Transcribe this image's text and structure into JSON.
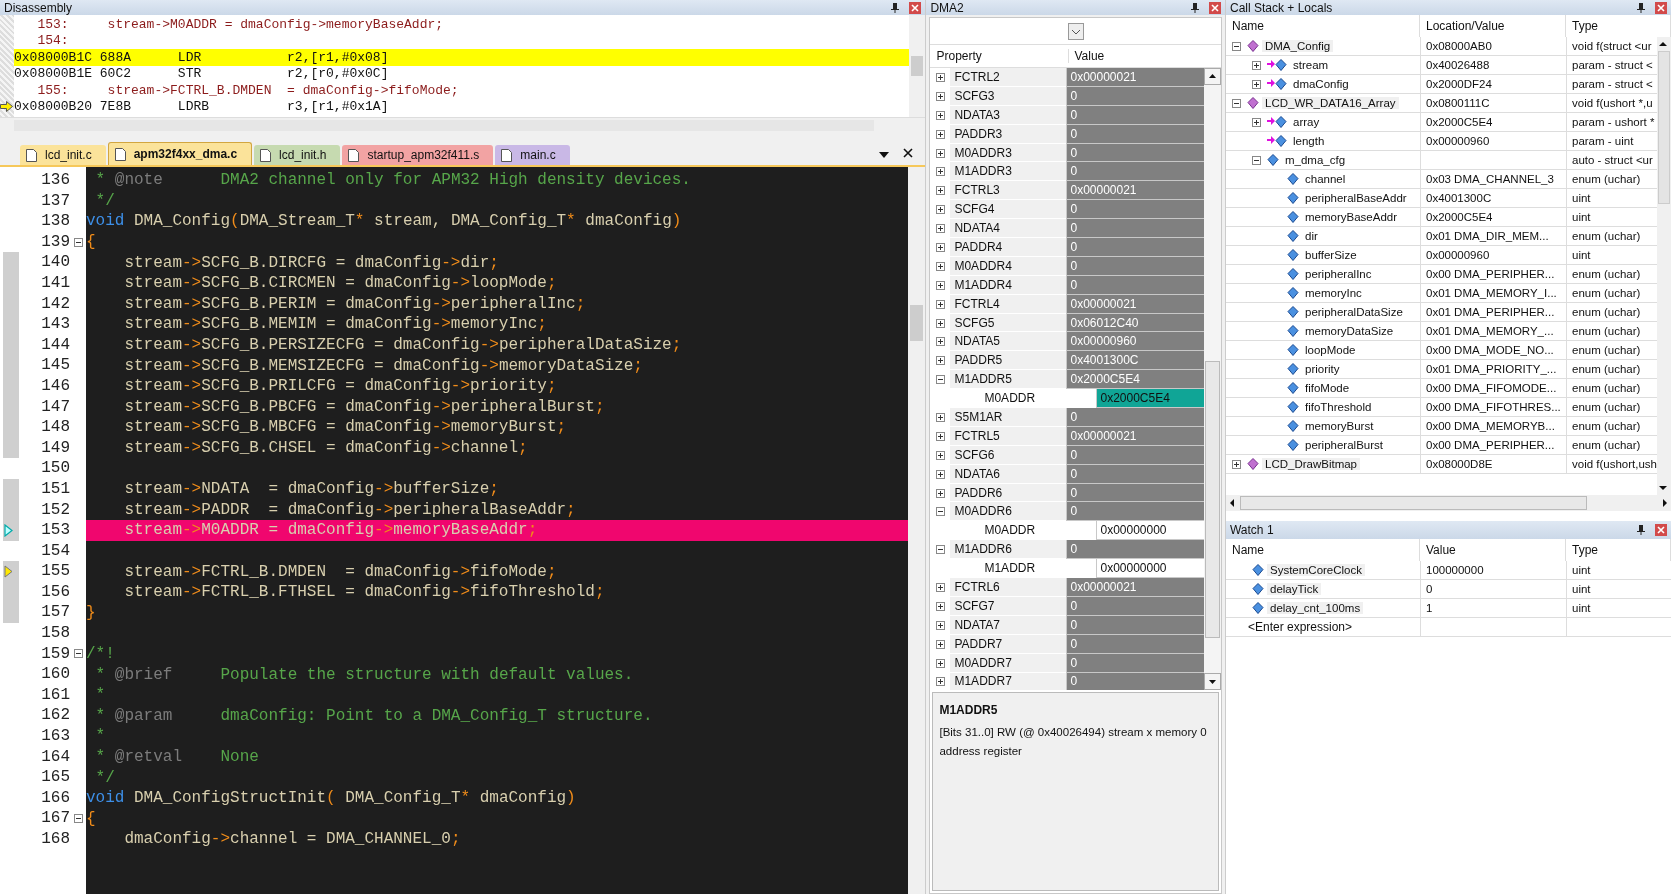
{
  "disassembly": {
    "title": "Disassembly",
    "lines": [
      {
        "kind": "source",
        "text": "   153:     stream->M0ADDR = dmaConfig->memoryBaseAddr;",
        "highlight": false,
        "current": false
      },
      {
        "kind": "source",
        "text": "   154:",
        "highlight": false,
        "current": false
      },
      {
        "kind": "asm",
        "text": "0x08000B1C 688A      LDR           r2,[r1,#0x08]",
        "highlight": true,
        "current": false
      },
      {
        "kind": "asm",
        "text": "0x08000B1E 60C2      STR           r2,[r0,#0x0C]",
        "highlight": false,
        "current": false
      },
      {
        "kind": "source",
        "text": "   155:     stream->FCTRL_B.DMDEN  = dmaConfig->fifoMode;",
        "highlight": false,
        "current": false
      },
      {
        "kind": "asm",
        "text": "0x08000B20 7E8B      LDRB          r3,[r1,#0x1A]",
        "highlight": false,
        "current": true
      }
    ]
  },
  "tabs": [
    {
      "label": "lcd_init.c",
      "selected": false,
      "color": "#fbe39a"
    },
    {
      "label": "apm32f4xx_dma.c",
      "selected": true,
      "color": "#fbe39a"
    },
    {
      "label": "lcd_init.h",
      "selected": false,
      "color": "#c6dab0"
    },
    {
      "label": "startup_apm32f411.s",
      "selected": false,
      "color": "#f2a3a3"
    },
    {
      "label": "main.c",
      "selected": false,
      "color": "#c9b8e6"
    }
  ],
  "editor": {
    "lines": [
      {
        "number": "136",
        "fold": false,
        "executed": false,
        "highlight": false,
        "parts": [
          {
            "kind": "comment",
            "text": " * "
          },
          {
            "kind": "tag",
            "text": "@note"
          },
          {
            "kind": "comment",
            "text": "      DMA2 channel only for APM32 High density devices."
          }
        ]
      },
      {
        "number": "137",
        "fold": false,
        "executed": false,
        "highlight": false,
        "parts": [
          {
            "kind": "comment",
            "text": " */"
          }
        ]
      },
      {
        "number": "138",
        "fold": false,
        "executed": false,
        "highlight": false,
        "parts": [
          {
            "kind": "keyword",
            "text": "void"
          },
          {
            "kind": "text",
            "text": " DMA_Config"
          },
          {
            "kind": "op",
            "text": "("
          },
          {
            "kind": "text",
            "text": "DMA_Stream_T"
          },
          {
            "kind": "op",
            "text": "*"
          },
          {
            "kind": "text",
            "text": " stream, DMA_Config_T"
          },
          {
            "kind": "op",
            "text": "*"
          },
          {
            "kind": "text",
            "text": " dmaConfig"
          },
          {
            "kind": "op",
            "text": ")"
          }
        ]
      },
      {
        "number": "139",
        "fold": true,
        "executed": false,
        "highlight": false,
        "parts": [
          {
            "kind": "op",
            "text": "{"
          }
        ]
      },
      {
        "number": "140",
        "fold": false,
        "executed": true,
        "highlight": false,
        "parts": [
          {
            "kind": "text",
            "text": "    stream"
          },
          {
            "kind": "op",
            "text": "->"
          },
          {
            "kind": "text",
            "text": "SCFG_B.DIRCFG = dmaConfig"
          },
          {
            "kind": "op",
            "text": "->"
          },
          {
            "kind": "text",
            "text": "dir"
          },
          {
            "kind": "op",
            "text": ";"
          }
        ]
      },
      {
        "number": "141",
        "fold": false,
        "executed": true,
        "highlight": false,
        "parts": [
          {
            "kind": "text",
            "text": "    stream"
          },
          {
            "kind": "op",
            "text": "->"
          },
          {
            "kind": "text",
            "text": "SCFG_B.CIRCMEN = dmaConfig"
          },
          {
            "kind": "op",
            "text": "->"
          },
          {
            "kind": "text",
            "text": "loopMode"
          },
          {
            "kind": "op",
            "text": ";"
          }
        ]
      },
      {
        "number": "142",
        "fold": false,
        "executed": true,
        "highlight": false,
        "parts": [
          {
            "kind": "text",
            "text": "    stream"
          },
          {
            "kind": "op",
            "text": "->"
          },
          {
            "kind": "text",
            "text": "SCFG_B.PERIM = dmaConfig"
          },
          {
            "kind": "op",
            "text": "->"
          },
          {
            "kind": "text",
            "text": "peripheralInc"
          },
          {
            "kind": "op",
            "text": ";"
          }
        ]
      },
      {
        "number": "143",
        "fold": false,
        "executed": true,
        "highlight": false,
        "parts": [
          {
            "kind": "text",
            "text": "    stream"
          },
          {
            "kind": "op",
            "text": "->"
          },
          {
            "kind": "text",
            "text": "SCFG_B.MEMIM = dmaConfig"
          },
          {
            "kind": "op",
            "text": "->"
          },
          {
            "kind": "text",
            "text": "memoryInc"
          },
          {
            "kind": "op",
            "text": ";"
          }
        ]
      },
      {
        "number": "144",
        "fold": false,
        "executed": true,
        "highlight": false,
        "parts": [
          {
            "kind": "text",
            "text": "    stream"
          },
          {
            "kind": "op",
            "text": "->"
          },
          {
            "kind": "text",
            "text": "SCFG_B.PERSIZECFG = dmaConfig"
          },
          {
            "kind": "op",
            "text": "->"
          },
          {
            "kind": "text",
            "text": "peripheralDataSize"
          },
          {
            "kind": "op",
            "text": ";"
          }
        ]
      },
      {
        "number": "145",
        "fold": false,
        "executed": true,
        "highlight": false,
        "parts": [
          {
            "kind": "text",
            "text": "    stream"
          },
          {
            "kind": "op",
            "text": "->"
          },
          {
            "kind": "text",
            "text": "SCFG_B.MEMSIZECFG = dmaConfig"
          },
          {
            "kind": "op",
            "text": "->"
          },
          {
            "kind": "text",
            "text": "memoryDataSize"
          },
          {
            "kind": "op",
            "text": ";"
          }
        ]
      },
      {
        "number": "146",
        "fold": false,
        "executed": true,
        "highlight": false,
        "parts": [
          {
            "kind": "text",
            "text": "    stream"
          },
          {
            "kind": "op",
            "text": "->"
          },
          {
            "kind": "text",
            "text": "SCFG_B.PRILCFG = dmaConfig"
          },
          {
            "kind": "op",
            "text": "->"
          },
          {
            "kind": "text",
            "text": "priority"
          },
          {
            "kind": "op",
            "text": ";"
          }
        ]
      },
      {
        "number": "147",
        "fold": false,
        "executed": true,
        "highlight": false,
        "parts": [
          {
            "kind": "text",
            "text": "    stream"
          },
          {
            "kind": "op",
            "text": "->"
          },
          {
            "kind": "text",
            "text": "SCFG_B.PBCFG = dmaConfig"
          },
          {
            "kind": "op",
            "text": "->"
          },
          {
            "kind": "text",
            "text": "peripheralBurst"
          },
          {
            "kind": "op",
            "text": ";"
          }
        ]
      },
      {
        "number": "148",
        "fold": false,
        "executed": true,
        "highlight": false,
        "parts": [
          {
            "kind": "text",
            "text": "    stream"
          },
          {
            "kind": "op",
            "text": "->"
          },
          {
            "kind": "text",
            "text": "SCFG_B.MBCFG = dmaConfig"
          },
          {
            "kind": "op",
            "text": "->"
          },
          {
            "kind": "text",
            "text": "memoryBurst"
          },
          {
            "kind": "op",
            "text": ";"
          }
        ]
      },
      {
        "number": "149",
        "fold": false,
        "executed": true,
        "highlight": false,
        "parts": [
          {
            "kind": "text",
            "text": "    stream"
          },
          {
            "kind": "op",
            "text": "->"
          },
          {
            "kind": "text",
            "text": "SCFG_B.CHSEL = dmaConfig"
          },
          {
            "kind": "op",
            "text": "->"
          },
          {
            "kind": "text",
            "text": "channel"
          },
          {
            "kind": "op",
            "text": ";"
          }
        ]
      },
      {
        "number": "150",
        "fold": false,
        "executed": false,
        "highlight": false
      },
      {
        "number": "151",
        "fold": false,
        "executed": true,
        "highlight": false,
        "parts": [
          {
            "kind": "text",
            "text": "    stream"
          },
          {
            "kind": "op",
            "text": "->"
          },
          {
            "kind": "text",
            "text": "NDATA  = dmaConfig"
          },
          {
            "kind": "op",
            "text": "->"
          },
          {
            "kind": "text",
            "text": "bufferSize"
          },
          {
            "kind": "op",
            "text": ";"
          }
        ]
      },
      {
        "number": "152",
        "fold": false,
        "executed": true,
        "highlight": false,
        "parts": [
          {
            "kind": "text",
            "text": "    stream"
          },
          {
            "kind": "op",
            "text": "->"
          },
          {
            "kind": "text",
            "text": "PADDR  = dmaConfig"
          },
          {
            "kind": "op",
            "text": "->"
          },
          {
            "kind": "text",
            "text": "peripheralBaseAddr"
          },
          {
            "kind": "op",
            "text": ";"
          }
        ]
      },
      {
        "number": "153",
        "fold": false,
        "executed": true,
        "highlight": true,
        "current": true,
        "parts": [
          {
            "kind": "text",
            "text": "    stream"
          },
          {
            "kind": "op",
            "text": "->"
          },
          {
            "kind": "text",
            "text": "M0ADDR = dmaConfig"
          },
          {
            "kind": "op",
            "text": "->"
          },
          {
            "kind": "text",
            "text": "memoryBaseAddr"
          },
          {
            "kind": "op",
            "text": ";"
          }
        ]
      },
      {
        "number": "154",
        "fold": false,
        "executed": false,
        "highlight": false
      },
      {
        "number": "155",
        "fold": false,
        "executed": true,
        "highlight": false,
        "caller": true,
        "parts": [
          {
            "kind": "text",
            "text": "    stream"
          },
          {
            "kind": "op",
            "text": "->"
          },
          {
            "kind": "text",
            "text": "FCTRL_B.DMDEN  = dmaConfig"
          },
          {
            "kind": "op",
            "text": "->"
          },
          {
            "kind": "text",
            "text": "fifoMode"
          },
          {
            "kind": "op",
            "text": ";"
          }
        ]
      },
      {
        "number": "156",
        "fold": false,
        "executed": true,
        "highlight": false,
        "parts": [
          {
            "kind": "text",
            "text": "    stream"
          },
          {
            "kind": "op",
            "text": "->"
          },
          {
            "kind": "text",
            "text": "FCTRL_B.FTHSEL = dmaConfig"
          },
          {
            "kind": "op",
            "text": "->"
          },
          {
            "kind": "text",
            "text": "fifoThreshold"
          },
          {
            "kind": "op",
            "text": ";"
          }
        ]
      },
      {
        "number": "157",
        "fold": false,
        "executed": true,
        "highlight": false,
        "parts": [
          {
            "kind": "op",
            "text": "}"
          }
        ]
      },
      {
        "number": "158",
        "fold": false,
        "executed": false,
        "highlight": false
      },
      {
        "number": "159",
        "fold": true,
        "executed": false,
        "highlight": false,
        "parts": [
          {
            "kind": "comment",
            "text": "/*!"
          }
        ]
      },
      {
        "number": "160",
        "fold": false,
        "executed": false,
        "highlight": false,
        "parts": [
          {
            "kind": "comment",
            "text": " * "
          },
          {
            "kind": "tag",
            "text": "@brief"
          },
          {
            "kind": "comment",
            "text": "     Populate the structure with default values."
          }
        ]
      },
      {
        "number": "161",
        "fold": false,
        "executed": false,
        "highlight": false,
        "parts": [
          {
            "kind": "comment",
            "text": " *"
          }
        ]
      },
      {
        "number": "162",
        "fold": false,
        "executed": false,
        "highlight": false,
        "parts": [
          {
            "kind": "comment",
            "text": " * "
          },
          {
            "kind": "tag",
            "text": "@param"
          },
          {
            "kind": "comment",
            "text": "     dmaConfig: Point to a DMA_Config_T structure."
          }
        ]
      },
      {
        "number": "163",
        "fold": false,
        "executed": false,
        "highlight": false,
        "parts": [
          {
            "kind": "comment",
            "text": " *"
          }
        ]
      },
      {
        "number": "164",
        "fold": false,
        "executed": false,
        "highlight": false,
        "parts": [
          {
            "kind": "comment",
            "text": " * "
          },
          {
            "kind": "tag",
            "text": "@retval"
          },
          {
            "kind": "comment",
            "text": "    None"
          }
        ]
      },
      {
        "number": "165",
        "fold": false,
        "executed": false,
        "highlight": false,
        "parts": [
          {
            "kind": "comment",
            "text": " */"
          }
        ]
      },
      {
        "number": "166",
        "fold": false,
        "executed": false,
        "highlight": false,
        "parts": [
          {
            "kind": "keyword",
            "text": "void"
          },
          {
            "kind": "text",
            "text": " DMA_ConfigStructInit"
          },
          {
            "kind": "op",
            "text": "("
          },
          {
            "kind": "text",
            "text": " DMA_Config_T"
          },
          {
            "kind": "op",
            "text": "*"
          },
          {
            "kind": "text",
            "text": " dmaConfig"
          },
          {
            "kind": "op",
            "text": ")"
          }
        ]
      },
      {
        "number": "167",
        "fold": true,
        "executed": false,
        "highlight": false,
        "parts": [
          {
            "kind": "op",
            "text": "{"
          }
        ]
      },
      {
        "number": "168",
        "fold": false,
        "executed": false,
        "highlight": false,
        "parts": [
          {
            "kind": "text",
            "text": "    dmaConfig"
          },
          {
            "kind": "op",
            "text": "->"
          },
          {
            "kind": "text",
            "text": "channel = DMA_CHANNEL_0"
          },
          {
            "kind": "op",
            "text": ";"
          }
        ]
      }
    ]
  },
  "dma2": {
    "title": "DMA2",
    "columns": [
      "Property",
      "Value"
    ],
    "rows": [
      {
        "name": "FCTRL2",
        "value": "0x00000021",
        "expanded": false
      },
      {
        "name": "SCFG3",
        "value": "0",
        "expanded": false
      },
      {
        "name": "NDATA3",
        "value": "0",
        "expanded": false
      },
      {
        "name": "PADDR3",
        "value": "0",
        "expanded": false
      },
      {
        "name": "M0ADDR3",
        "value": "0",
        "expanded": false
      },
      {
        "name": "M1ADDR3",
        "value": "0",
        "expanded": false
      },
      {
        "name": "FCTRL3",
        "value": "0x00000021",
        "expanded": false
      },
      {
        "name": "SCFG4",
        "value": "0",
        "expanded": false
      },
      {
        "name": "NDATA4",
        "value": "0",
        "expanded": false
      },
      {
        "name": "PADDR4",
        "value": "0",
        "expanded": false
      },
      {
        "name": "M0ADDR4",
        "value": "0",
        "expanded": false
      },
      {
        "name": "M1ADDR4",
        "value": "0",
        "expanded": false
      },
      {
        "name": "FCTRL4",
        "value": "0x00000021",
        "expanded": false
      },
      {
        "name": "SCFG5",
        "value": "0x06012C40",
        "expanded": false
      },
      {
        "name": "NDATA5",
        "value": "0x00000960",
        "expanded": false
      },
      {
        "name": "PADDR5",
        "value": "0x4001300C",
        "expanded": false
      },
      {
        "name": "M1ADDR5",
        "value": "0x2000C5E4",
        "expanded": true,
        "children": [
          {
            "name": "M0ADDR",
            "value": "0x2000C5E4",
            "selected": true
          }
        ]
      },
      {
        "name": "S5M1AR",
        "value": "0",
        "expanded": false
      },
      {
        "name": "FCTRL5",
        "value": "0x00000021",
        "expanded": false
      },
      {
        "name": "SCFG6",
        "value": "0",
        "expanded": false
      },
      {
        "name": "NDATA6",
        "value": "0",
        "expanded": false
      },
      {
        "name": "PADDR6",
        "value": "0",
        "expanded": false
      },
      {
        "name": "M0ADDR6",
        "value": "0",
        "expanded": true,
        "children": [
          {
            "name": "M0ADDR",
            "value": "0x00000000",
            "selected": false
          }
        ]
      },
      {
        "name": "M1ADDR6",
        "value": "0",
        "expanded": true,
        "children": [
          {
            "name": "M1ADDR",
            "value": "0x00000000",
            "selected": false
          }
        ]
      },
      {
        "name": "FCTRL6",
        "value": "0x00000021",
        "expanded": false
      },
      {
        "name": "SCFG7",
        "value": "0",
        "expanded": false
      },
      {
        "name": "NDATA7",
        "value": "0",
        "expanded": false
      },
      {
        "name": "PADDR7",
        "value": "0",
        "expanded": false
      },
      {
        "name": "M0ADDR7",
        "value": "0",
        "expanded": false
      },
      {
        "name": "M1ADDR7",
        "value": "0",
        "expanded": false
      }
    ],
    "description": {
      "title": "M1ADDR5",
      "text": "[Bits 31..0] RW (@ 0x40026494) stream x memory 0 address  register"
    }
  },
  "call_stack": {
    "title": "Call Stack + Locals",
    "columns": [
      "Name",
      "Location/Value",
      "Type"
    ],
    "rows": [
      {
        "kind": "function",
        "name": "DMA_Config",
        "value": "0x08000AB0",
        "type": "void f(struct <ur",
        "expanded": true,
        "children": [
          {
            "kind": "param",
            "name": "stream",
            "value": "0x40026488",
            "type": "param - struct <",
            "expanded": false
          },
          {
            "kind": "param",
            "name": "dmaConfig",
            "value": "0x2000DF24",
            "type": "param - struct <",
            "expanded": false
          }
        ]
      },
      {
        "kind": "function",
        "name": "LCD_WR_DATA16_Array",
        "value": "0x0800111C",
        "type": "void f(ushort *,u",
        "expanded": true,
        "children": [
          {
            "kind": "param",
            "name": "array",
            "value": "0x2000C5E4",
            "type": "param - ushort *",
            "expanded": false
          },
          {
            "kind": "param",
            "name": "length",
            "value": "0x00000960",
            "type": "param - uint"
          },
          {
            "kind": "local",
            "name": "m_dma_cfg",
            "type": "auto - struct <ur",
            "expanded": true,
            "children": [
              {
                "kind": "local",
                "name": "channel",
                "value": "0x03 DMA_CHANNEL_3",
                "type": "enum (uchar)"
              },
              {
                "kind": "local",
                "name": "peripheralBaseAddr",
                "value": "0x4001300C",
                "type": "uint"
              },
              {
                "kind": "local",
                "name": "memoryBaseAddr",
                "value": "0x2000C5E4",
                "type": "uint"
              },
              {
                "kind": "local",
                "name": "dir",
                "value": "0x01 DMA_DIR_MEM...",
                "type": "enum (uchar)"
              },
              {
                "kind": "local",
                "name": "bufferSize",
                "value": "0x00000960",
                "type": "uint"
              },
              {
                "kind": "local",
                "name": "peripheralInc",
                "value": "0x00 DMA_PERIPHER...",
                "type": "enum (uchar)"
              },
              {
                "kind": "local",
                "name": "memoryInc",
                "value": "0x01 DMA_MEMORY_I...",
                "type": "enum (uchar)"
              },
              {
                "kind": "local",
                "name": "peripheralDataSize",
                "value": "0x01 DMA_PERIPHER...",
                "type": "enum (uchar)"
              },
              {
                "kind": "local",
                "name": "memoryDataSize",
                "value": "0x01 DMA_MEMORY_...",
                "type": "enum (uchar)"
              },
              {
                "kind": "local",
                "name": "loopMode",
                "value": "0x00 DMA_MODE_NO...",
                "type": "enum (uchar)"
              },
              {
                "kind": "local",
                "name": "priority",
                "value": "0x01 DMA_PRIORITY_...",
                "type": "enum (uchar)"
              },
              {
                "kind": "local",
                "name": "fifoMode",
                "value": "0x00 DMA_FIFOMODE...",
                "type": "enum (uchar)"
              },
              {
                "kind": "local",
                "name": "fifoThreshold",
                "value": "0x00 DMA_FIFOTHRES...",
                "type": "enum (uchar)"
              },
              {
                "kind": "local",
                "name": "memoryBurst",
                "value": "0x00 DMA_MEMORYB...",
                "type": "enum (uchar)"
              },
              {
                "kind": "local",
                "name": "peripheralBurst",
                "value": "0x00 DMA_PERIPHER...",
                "type": "enum (uchar)"
              }
            ]
          }
        ]
      },
      {
        "kind": "function",
        "name": "LCD_DrawBitmap",
        "value": "0x08000D8E",
        "type": "void f(ushort,ush",
        "expanded": false
      }
    ]
  },
  "watch": {
    "title": "Watch 1",
    "columns": [
      "Name",
      "Value",
      "Type"
    ],
    "rows": [
      {
        "name": "SystemCoreClock",
        "value": "100000000",
        "type": "uint"
      },
      {
        "name": "delayTick",
        "value": "0",
        "type": "uint"
      },
      {
        "name": "delay_cnt_100ms",
        "value": "1",
        "type": "uint"
      }
    ],
    "placeholder": "<Enter expression>"
  }
}
